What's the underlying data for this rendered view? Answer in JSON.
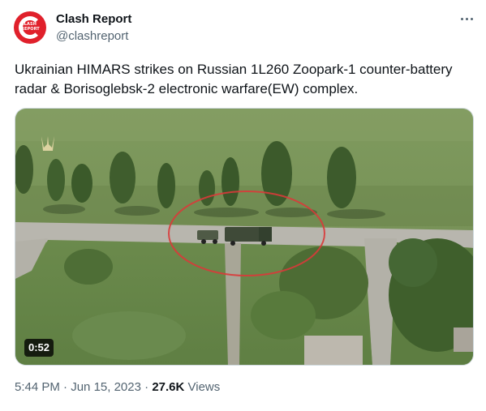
{
  "author": {
    "name": "Clash Report",
    "handle": "@clashreport",
    "avatar_text": "CLASH REPORT",
    "brand_color": "#e0202b",
    "more_icon": "more-horizontal-icon"
  },
  "tweet": {
    "text": "Ukrainian HIMARS strikes on Russian 1L260 Zoopark-1 counter-battery radar & Borisoglebsk-2 electronic warfare(EW) complex."
  },
  "media": {
    "type": "video",
    "duration": "0:52",
    "watermark_icon": "trident-icon",
    "annotation_color": "#d93a3a"
  },
  "meta": {
    "time": "5:44 PM",
    "separator": "·",
    "date": "Jun 15, 2023",
    "views_count": "27.6K",
    "views_label": "Views"
  }
}
